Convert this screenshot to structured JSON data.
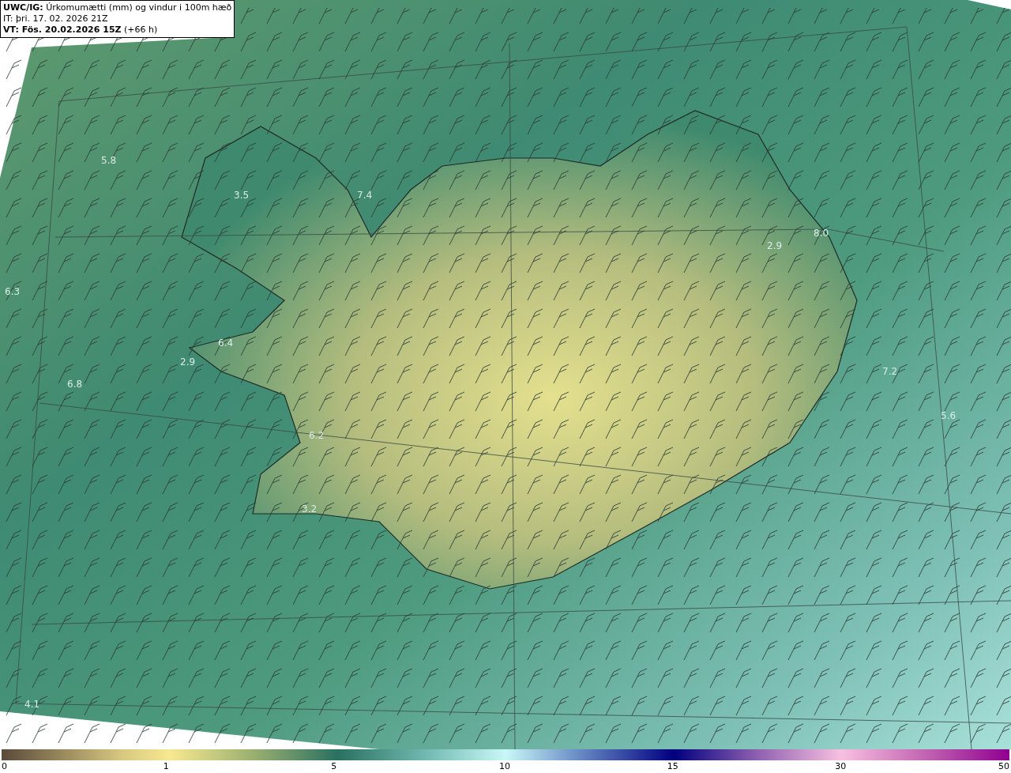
{
  "header": {
    "title": "**UWC/IG:** Úrkomumætti (mm) og vindur i 100m hæð",
    "issue_time": "IT: þri. 17. 02. 2026 21Z",
    "valid_time": "**VT: Fös. 20.02.2026 15Z** (+66 h)"
  },
  "map_values": [
    "5.8",
    "3.5",
    "7.4",
    "6.3",
    "6.4",
    "2.9",
    "6.8",
    "6.2",
    "3.2",
    "4.1",
    "2.9",
    "8.0",
    "7.2",
    "5.6"
  ],
  "colorbar": {
    "ticks": [
      "0",
      "1",
      "5",
      "10",
      "15",
      "30",
      "50"
    ]
  }
}
